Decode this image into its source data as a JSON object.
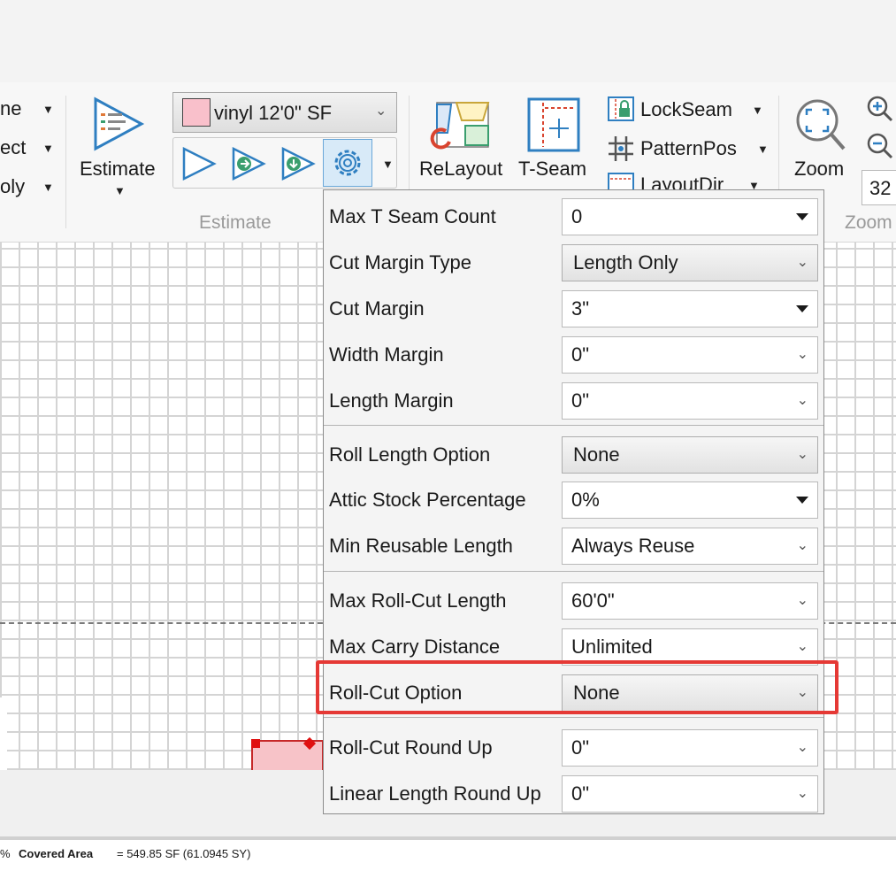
{
  "ribbon": {
    "left_items": [
      {
        "label": "ne"
      },
      {
        "label": "ect"
      },
      {
        "label": "oly"
      }
    ],
    "estimate_label": "Estimate",
    "estimate_group_label": "Estimate",
    "product_select": {
      "value": "vinyl 12'0\" SF",
      "swatch_color": "#f9c0cb"
    },
    "relayout_label": "ReLayout",
    "tseam_label": "T-Seam",
    "lockseam_label": "LockSeam",
    "patternpos_label": "PatternPos",
    "layoutdir_label": "LayoutDir",
    "zoom_label": "Zoom",
    "zoom_value": "32",
    "zoom_group_label": "Zoom"
  },
  "settings_panel": {
    "rows": [
      {
        "label": "Max T Seam Count",
        "value": "0"
      },
      {
        "label": "Cut Margin Type",
        "value": "Length Only"
      },
      {
        "label": "Cut Margin",
        "value": "3\""
      },
      {
        "label": "Width Margin",
        "value": "0\""
      },
      {
        "label": "Length Margin",
        "value": "0\""
      },
      {
        "label": "Roll Length Option",
        "value": "None"
      },
      {
        "label": "Attic Stock Percentage",
        "value": "0%"
      },
      {
        "label": "Min Reusable Length",
        "value": "Always Reuse"
      },
      {
        "label": "Max Roll-Cut Length",
        "value": "60'0\""
      },
      {
        "label": "Max Carry Distance",
        "value": "Unlimited"
      },
      {
        "label": "Roll-Cut Option",
        "value": "None"
      },
      {
        "label": "Roll-Cut Round Up",
        "value": "0\""
      },
      {
        "label": "Linear Length Round Up",
        "value": "0\""
      }
    ]
  },
  "status": {
    "prefix": "%",
    "covered_label": "Covered Area",
    "covered_value": "= 549.85 SF (61.0945 SY)"
  },
  "colors": {
    "highlight": "#e53935",
    "accent_icon": "#2f7fc1",
    "green_icon": "#3a9e6e"
  }
}
